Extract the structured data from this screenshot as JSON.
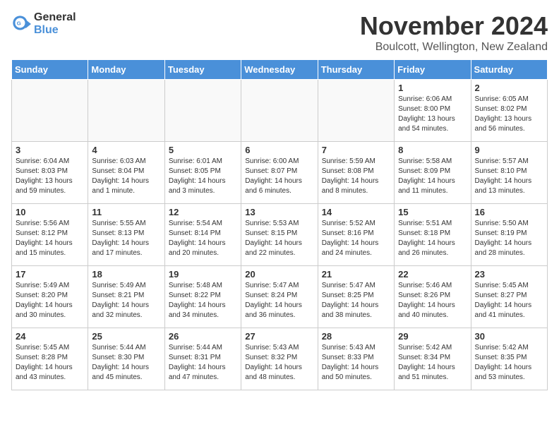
{
  "header": {
    "logo_general": "General",
    "logo_blue": "Blue",
    "month_year": "November 2024",
    "location": "Boulcott, Wellington, New Zealand"
  },
  "weekdays": [
    "Sunday",
    "Monday",
    "Tuesday",
    "Wednesday",
    "Thursday",
    "Friday",
    "Saturday"
  ],
  "weeks": [
    [
      {
        "day": "",
        "info": ""
      },
      {
        "day": "",
        "info": ""
      },
      {
        "day": "",
        "info": ""
      },
      {
        "day": "",
        "info": ""
      },
      {
        "day": "",
        "info": ""
      },
      {
        "day": "1",
        "info": "Sunrise: 6:06 AM\nSunset: 8:00 PM\nDaylight: 13 hours\nand 54 minutes."
      },
      {
        "day": "2",
        "info": "Sunrise: 6:05 AM\nSunset: 8:02 PM\nDaylight: 13 hours\nand 56 minutes."
      }
    ],
    [
      {
        "day": "3",
        "info": "Sunrise: 6:04 AM\nSunset: 8:03 PM\nDaylight: 13 hours\nand 59 minutes."
      },
      {
        "day": "4",
        "info": "Sunrise: 6:03 AM\nSunset: 8:04 PM\nDaylight: 14 hours\nand 1 minute."
      },
      {
        "day": "5",
        "info": "Sunrise: 6:01 AM\nSunset: 8:05 PM\nDaylight: 14 hours\nand 3 minutes."
      },
      {
        "day": "6",
        "info": "Sunrise: 6:00 AM\nSunset: 8:07 PM\nDaylight: 14 hours\nand 6 minutes."
      },
      {
        "day": "7",
        "info": "Sunrise: 5:59 AM\nSunset: 8:08 PM\nDaylight: 14 hours\nand 8 minutes."
      },
      {
        "day": "8",
        "info": "Sunrise: 5:58 AM\nSunset: 8:09 PM\nDaylight: 14 hours\nand 11 minutes."
      },
      {
        "day": "9",
        "info": "Sunrise: 5:57 AM\nSunset: 8:10 PM\nDaylight: 14 hours\nand 13 minutes."
      }
    ],
    [
      {
        "day": "10",
        "info": "Sunrise: 5:56 AM\nSunset: 8:12 PM\nDaylight: 14 hours\nand 15 minutes."
      },
      {
        "day": "11",
        "info": "Sunrise: 5:55 AM\nSunset: 8:13 PM\nDaylight: 14 hours\nand 17 minutes."
      },
      {
        "day": "12",
        "info": "Sunrise: 5:54 AM\nSunset: 8:14 PM\nDaylight: 14 hours\nand 20 minutes."
      },
      {
        "day": "13",
        "info": "Sunrise: 5:53 AM\nSunset: 8:15 PM\nDaylight: 14 hours\nand 22 minutes."
      },
      {
        "day": "14",
        "info": "Sunrise: 5:52 AM\nSunset: 8:16 PM\nDaylight: 14 hours\nand 24 minutes."
      },
      {
        "day": "15",
        "info": "Sunrise: 5:51 AM\nSunset: 8:18 PM\nDaylight: 14 hours\nand 26 minutes."
      },
      {
        "day": "16",
        "info": "Sunrise: 5:50 AM\nSunset: 8:19 PM\nDaylight: 14 hours\nand 28 minutes."
      }
    ],
    [
      {
        "day": "17",
        "info": "Sunrise: 5:49 AM\nSunset: 8:20 PM\nDaylight: 14 hours\nand 30 minutes."
      },
      {
        "day": "18",
        "info": "Sunrise: 5:49 AM\nSunset: 8:21 PM\nDaylight: 14 hours\nand 32 minutes."
      },
      {
        "day": "19",
        "info": "Sunrise: 5:48 AM\nSunset: 8:22 PM\nDaylight: 14 hours\nand 34 minutes."
      },
      {
        "day": "20",
        "info": "Sunrise: 5:47 AM\nSunset: 8:24 PM\nDaylight: 14 hours\nand 36 minutes."
      },
      {
        "day": "21",
        "info": "Sunrise: 5:47 AM\nSunset: 8:25 PM\nDaylight: 14 hours\nand 38 minutes."
      },
      {
        "day": "22",
        "info": "Sunrise: 5:46 AM\nSunset: 8:26 PM\nDaylight: 14 hours\nand 40 minutes."
      },
      {
        "day": "23",
        "info": "Sunrise: 5:45 AM\nSunset: 8:27 PM\nDaylight: 14 hours\nand 41 minutes."
      }
    ],
    [
      {
        "day": "24",
        "info": "Sunrise: 5:45 AM\nSunset: 8:28 PM\nDaylight: 14 hours\nand 43 minutes."
      },
      {
        "day": "25",
        "info": "Sunrise: 5:44 AM\nSunset: 8:30 PM\nDaylight: 14 hours\nand 45 minutes."
      },
      {
        "day": "26",
        "info": "Sunrise: 5:44 AM\nSunset: 8:31 PM\nDaylight: 14 hours\nand 47 minutes."
      },
      {
        "day": "27",
        "info": "Sunrise: 5:43 AM\nSunset: 8:32 PM\nDaylight: 14 hours\nand 48 minutes."
      },
      {
        "day": "28",
        "info": "Sunrise: 5:43 AM\nSunset: 8:33 PM\nDaylight: 14 hours\nand 50 minutes."
      },
      {
        "day": "29",
        "info": "Sunrise: 5:42 AM\nSunset: 8:34 PM\nDaylight: 14 hours\nand 51 minutes."
      },
      {
        "day": "30",
        "info": "Sunrise: 5:42 AM\nSunset: 8:35 PM\nDaylight: 14 hours\nand 53 minutes."
      }
    ]
  ]
}
